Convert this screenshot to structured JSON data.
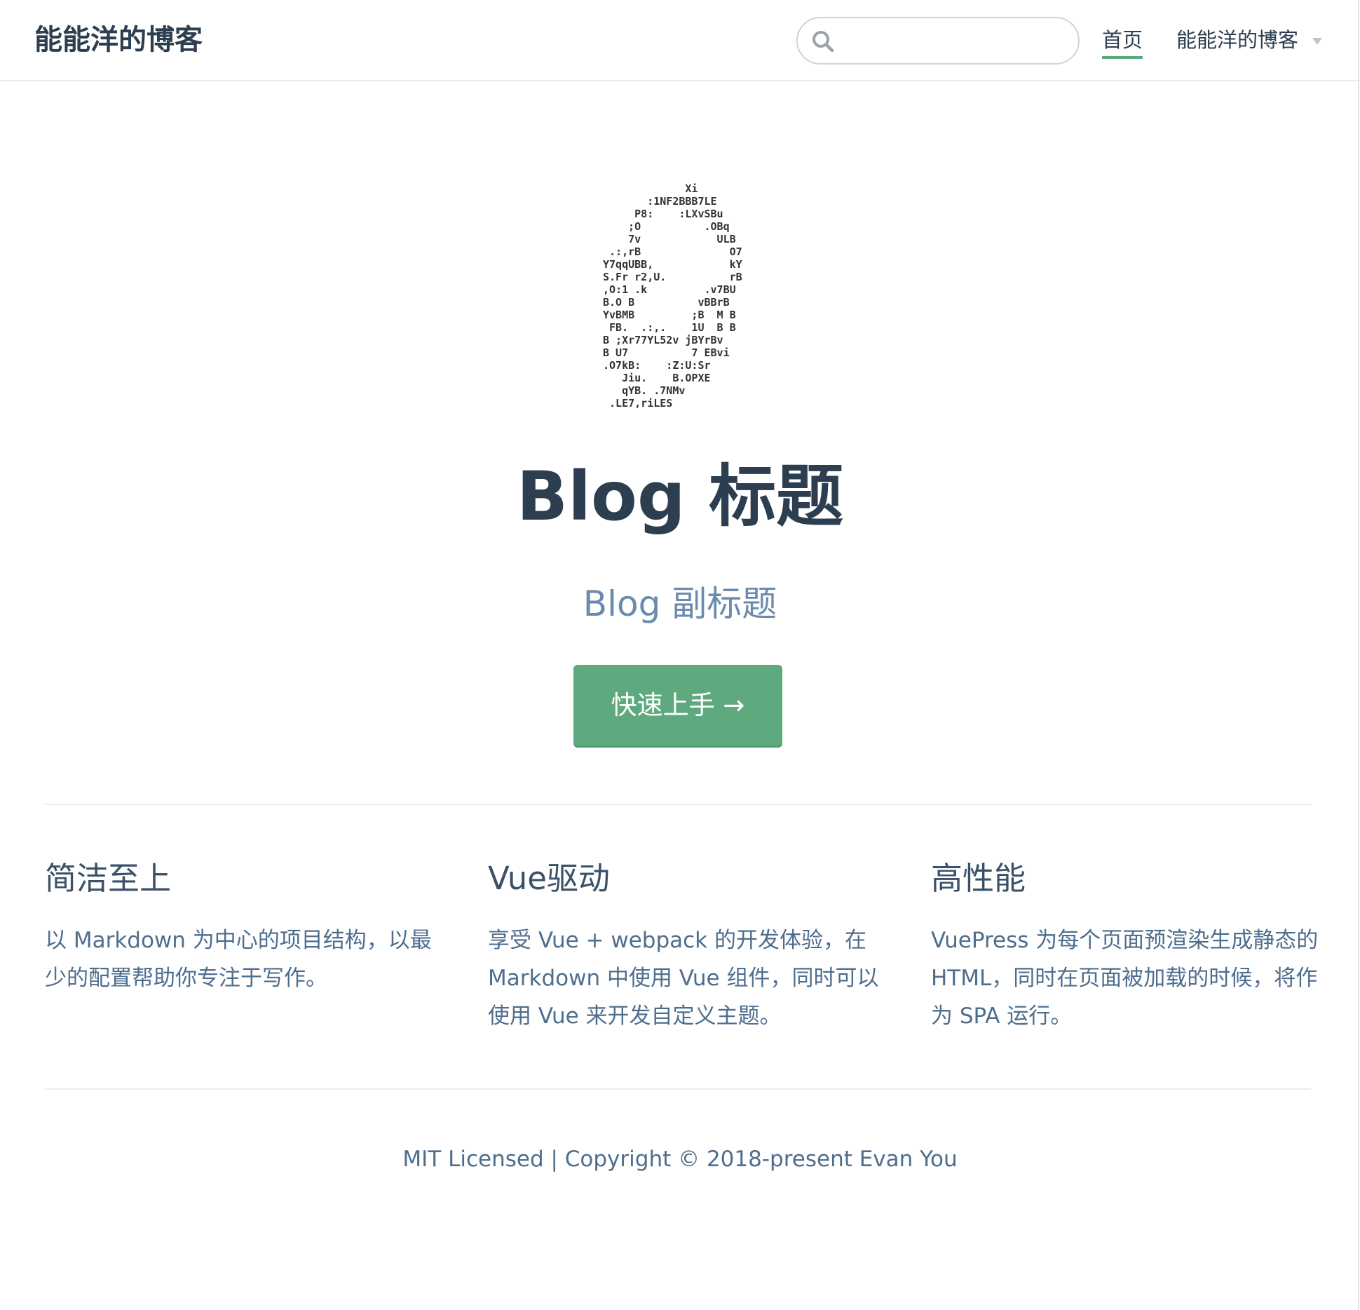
{
  "navbar": {
    "site_name": "能能洋的博客",
    "search": {
      "value": "",
      "placeholder": ""
    },
    "links": [
      {
        "label": "首页",
        "active": true
      },
      {
        "label": "能能洋的博客",
        "has_dropdown": true
      }
    ]
  },
  "hero": {
    "image_ascii": "             Xi\n       :1NF2BBB7LE\n     P8:    :LXvSBu\n    ;O          .OBq\n    7v            ULB\n .:,rB              O7\nY7qqUBB,            kY\nS.Fr r2,U.          rB\n,O:1 .k         .v7BU\nB.O B          vBBrB\nYvBMB         ;B  M B\n FB.  .:,.    1U  B B\nB ;Xr77YL52v jBYrBv\nB U7          7 EBvi\n.O7kB:    :Z:U:Sr\n   Jiu.    B.OPXE\n   qYB. .7NMv\n .LE7,riLES",
    "title": "Blog 标题",
    "subtitle": "Blog 副标题",
    "action_label": "快速上手 →"
  },
  "features": [
    {
      "title": "简洁至上",
      "details": "以 Markdown 为中心的项目结构，以最少的配置帮助你专注于写作。"
    },
    {
      "title": "Vue驱动",
      "details": "享受 Vue + webpack 的开发体验，在 Markdown 中使用 Vue 组件，同时可以使用 Vue 来开发自定义主题。"
    },
    {
      "title": "高性能",
      "details": "VuePress 为每个页面预渲染生成静态的 HTML，同时在页面被加载的时候，将作为 SPA 运行。"
    }
  ],
  "footer": {
    "text": "MIT Licensed | Copyright © 2018-present Evan You"
  },
  "colors": {
    "accent": "#5eaa7e",
    "text": "#2c3e50",
    "subtitle": "#6a8bad",
    "border": "#eaecef"
  },
  "icons": {
    "search": "search-icon",
    "dropdown": "chevron-down-icon"
  }
}
